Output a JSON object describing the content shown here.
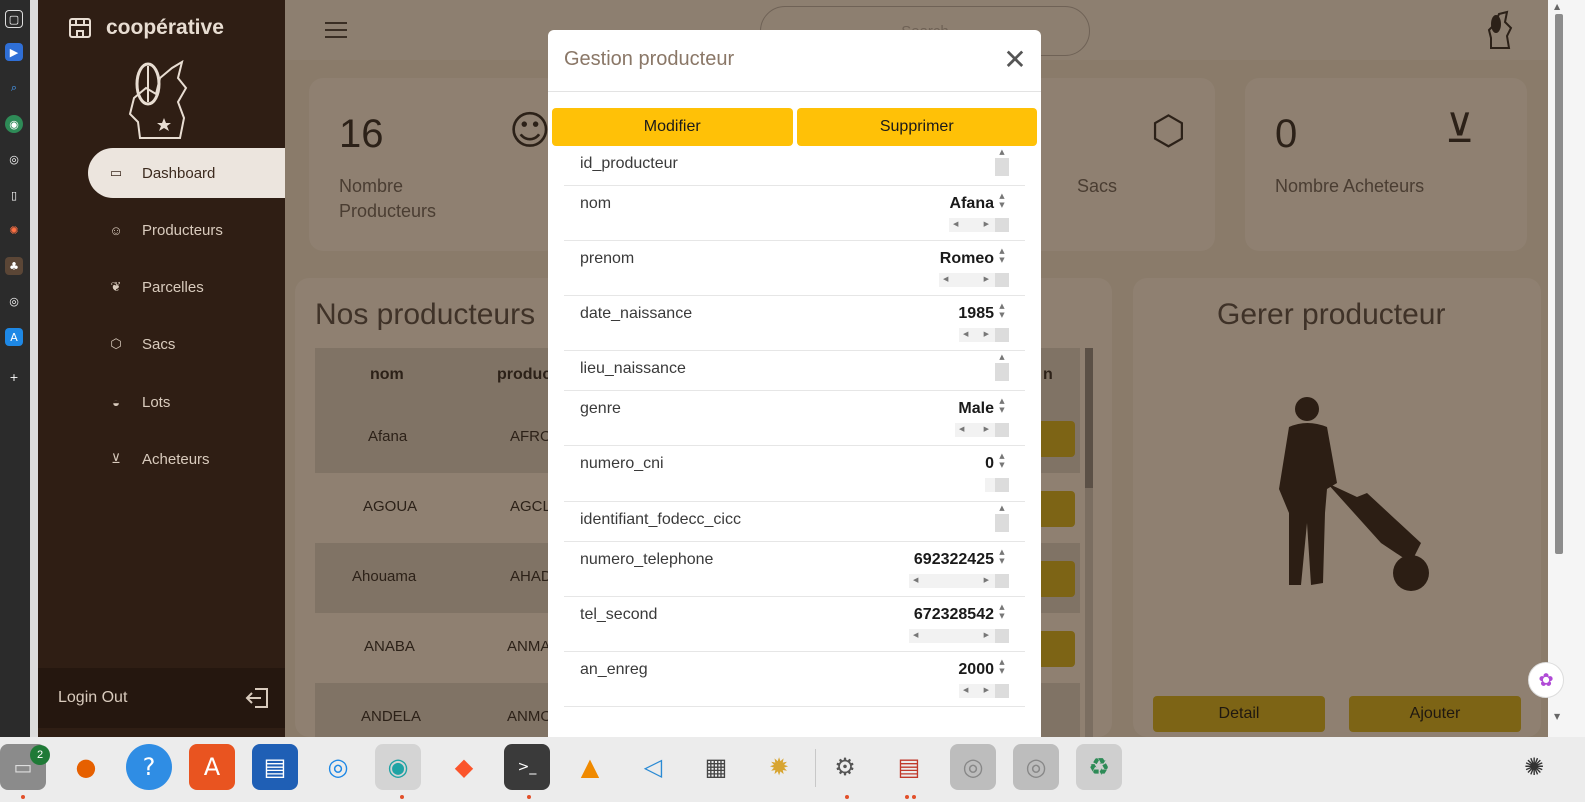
{
  "app": {
    "brand": "coopérative",
    "search_placeholder": "Search"
  },
  "sidebar": {
    "items": [
      {
        "label": "Dashboard",
        "icon": "presentation-icon"
      },
      {
        "label": "Producteurs",
        "icon": "user-icon"
      },
      {
        "label": "Parcelles",
        "icon": "leaf-icon"
      },
      {
        "label": "Sacs",
        "icon": "box-icon"
      },
      {
        "label": "Lots",
        "icon": "basket-icon"
      },
      {
        "label": "Acheteurs",
        "icon": "cart-icon"
      }
    ],
    "logout_label": "Login Out"
  },
  "stats": {
    "producteurs": {
      "value": "16",
      "label_line1": "Nombre",
      "label_line2": "Producteurs"
    },
    "sacs": {
      "label": "Sacs"
    },
    "acheteurs": {
      "value": "0",
      "label": "Nombre Acheteurs"
    }
  },
  "table": {
    "title": "Nos producteurs",
    "columns": [
      "nom",
      "produc",
      "n"
    ],
    "rows": [
      {
        "nom": "Afana",
        "code": "AFRO"
      },
      {
        "nom": "AGOUA",
        "code": "AGCL"
      },
      {
        "nom": "Ahouama",
        "code": "AHAD"
      },
      {
        "nom": "ANABA",
        "code": "ANMA"
      },
      {
        "nom": "ANDELA",
        "code": "ANMO"
      }
    ]
  },
  "manage_panel": {
    "title": "Gerer producteur",
    "detail_label": "Detail",
    "add_label": "Ajouter"
  },
  "modal": {
    "title": "Gestion producteur",
    "close_glyph": "✕",
    "modify_label": "Modifier",
    "delete_label": "Supprimer",
    "fields": [
      {
        "name": "id_producteur",
        "value": ""
      },
      {
        "name": "nom",
        "value": "Afana"
      },
      {
        "name": "prenom",
        "value": "Romeo"
      },
      {
        "name": "date_naissance",
        "value": "1985"
      },
      {
        "name": "lieu_naissance",
        "value": ""
      },
      {
        "name": "genre",
        "value": "Male"
      },
      {
        "name": "numero_cni",
        "value": "0"
      },
      {
        "name": "identifiant_fodecc_cicc",
        "value": ""
      },
      {
        "name": "numero_telephone",
        "value": "692322425"
      },
      {
        "name": "tel_second",
        "value": "672328542"
      },
      {
        "name": "an_enreg",
        "value": "2000"
      }
    ]
  },
  "taskbar": {
    "files_badge": "2",
    "help_glyph": "?"
  }
}
